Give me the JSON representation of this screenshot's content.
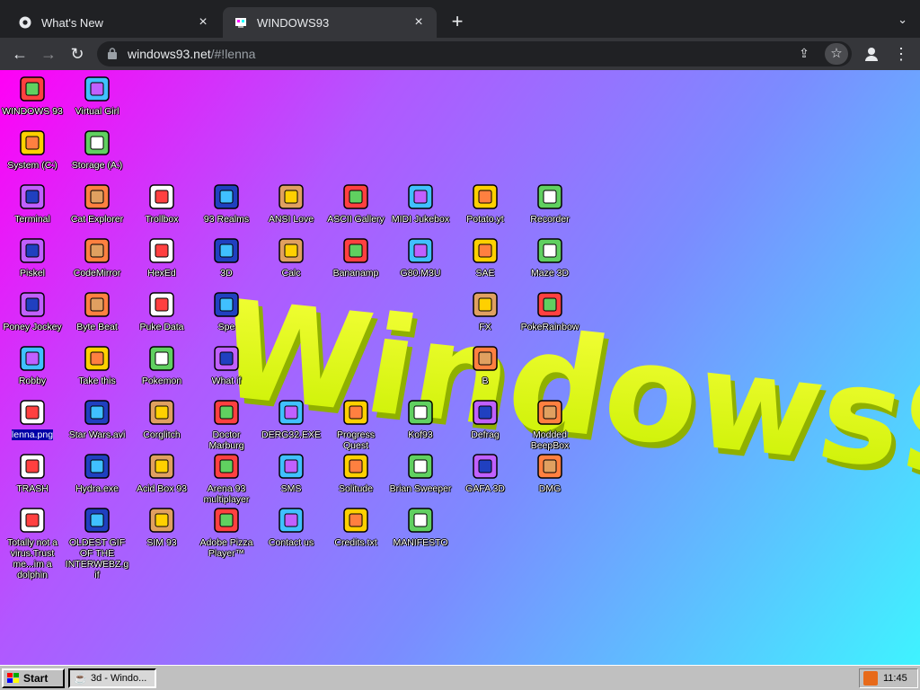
{
  "browser": {
    "tabs": [
      {
        "title": "What's New",
        "active": false
      },
      {
        "title": "WINDOWS93",
        "active": true
      }
    ],
    "url_host": "windows93.net",
    "url_path": "/#!lenna"
  },
  "desktop": {
    "logo_text": "Windows93",
    "icons": [
      {
        "label": "WINDOWS 93",
        "icon": "computer-icon"
      },
      {
        "label": "Virtual Girl",
        "icon": "face-icon"
      },
      {
        "label": "System (C:)",
        "icon": "drive-icon"
      },
      {
        "label": "Storage (A:)",
        "icon": "floppy-drive-icon"
      },
      {
        "label": "Terminal",
        "icon": "terminal-icon"
      },
      {
        "label": "Cat Explorer",
        "icon": "globe-cat-icon"
      },
      {
        "label": "Trollbox",
        "icon": "chat-face-icon"
      },
      {
        "label": "93 Realms",
        "icon": "dragon-icon"
      },
      {
        "label": "ANSI Love",
        "icon": "letter-a-icon"
      },
      {
        "label": "ASCII Gallery",
        "icon": "numbers-icon"
      },
      {
        "label": "MIDI Jukebox",
        "icon": "piano-icon"
      },
      {
        "label": "Potato.yt",
        "icon": "potato-icon"
      },
      {
        "label": "Recorder",
        "icon": "microphone-icon"
      },
      {
        "label": "Piskel",
        "icon": "palette-icon"
      },
      {
        "label": "CodeMirror",
        "icon": "cat-icon"
      },
      {
        "label": "HexEd",
        "icon": "cube-icon"
      },
      {
        "label": "3D",
        "icon": "teapot-icon"
      },
      {
        "label": "Calc",
        "icon": "calculator-icon"
      },
      {
        "label": "Bananamp",
        "icon": "banana-icon"
      },
      {
        "label": "G80.M3U",
        "icon": "music-file-icon"
      },
      {
        "label": "SAE",
        "icon": "ball-icon"
      },
      {
        "label": "Maze 3D",
        "icon": "maze-icon"
      },
      {
        "label": "Poney Jockey",
        "icon": "pony-icon"
      },
      {
        "label": "Byte Beat",
        "icon": "byte-beat-icon"
      },
      {
        "label": "Puke Data",
        "icon": "pd-icon"
      },
      {
        "label": "Spe",
        "icon": "speaker-icon"
      },
      {
        "label": "FX",
        "icon": "atom-icon"
      },
      {
        "label": "PokeRainbow",
        "icon": "pokemon-icon"
      },
      {
        "label": "Robby",
        "icon": "stick-figure-icon"
      },
      {
        "label": "Take this",
        "icon": "character-icon"
      },
      {
        "label": "Pokemon",
        "icon": "pokemon-ball-icon"
      },
      {
        "label": "What if",
        "icon": "chart-icon"
      },
      {
        "label": "B",
        "icon": "b-icon"
      },
      {
        "label": "lenna.png",
        "icon": "image-file-icon"
      },
      {
        "label": "Star Wars.avi",
        "icon": "yoda-icon"
      },
      {
        "label": "Corglitch",
        "icon": "corgi-icon"
      },
      {
        "label": "Doctor Marburg",
        "icon": "doctor-icon"
      },
      {
        "label": "DERG32.EXE",
        "icon": "monitor-face-icon"
      },
      {
        "label": "Progress Quest",
        "icon": "swords-icon"
      },
      {
        "label": "Kof93",
        "icon": "fighter-icon"
      },
      {
        "label": "Defrag",
        "icon": "defrag-icon"
      },
      {
        "label": "Modded BeepBox",
        "icon": "beepbox-icon"
      },
      {
        "label": "TRASH",
        "icon": "trash-icon"
      },
      {
        "label": "Hydra.exe",
        "icon": "hydra-icon"
      },
      {
        "label": "Acid Box 93",
        "icon": "smiley-icon"
      },
      {
        "label": "Arena 93 multiplayer",
        "icon": "arena-cube-icon"
      },
      {
        "label": "SMS",
        "icon": "console-icon"
      },
      {
        "label": "Solitude",
        "icon": "bottle-icon"
      },
      {
        "label": "Brian Sweeper",
        "icon": "mine-icon"
      },
      {
        "label": "GAFA 3D",
        "icon": "doom-face-icon"
      },
      {
        "label": "DMG",
        "icon": "gameboy-icon"
      },
      {
        "label": "Totally not a virus.Trust me...im a dolphin",
        "icon": "dolphin-shortcut-icon"
      },
      {
        "label": "OLDEST GIF OF THE INTERWEBZ.gif",
        "icon": "gif-file-icon"
      },
      {
        "label": "SIM 93",
        "icon": "book-icon"
      },
      {
        "label": "Adobe Pizza Player™",
        "icon": "pizza-icon"
      },
      {
        "label": "Contact us",
        "icon": "contact-icon"
      },
      {
        "label": "Credits.txt",
        "icon": "text-file-icon"
      },
      {
        "label": "MANIFESTO",
        "icon": "question-icon"
      }
    ]
  },
  "taskbar": {
    "start_label": "Start",
    "task_label": "3d - Windo...",
    "clock": "11:45"
  }
}
